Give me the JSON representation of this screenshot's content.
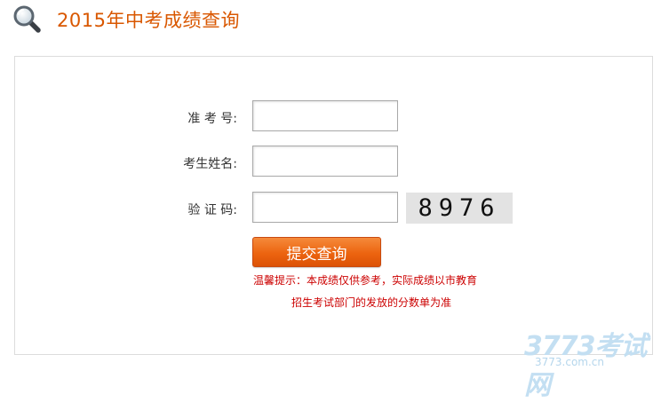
{
  "header": {
    "icon": "search-icon",
    "title": "2015年中考成绩查询"
  },
  "form": {
    "exam_number_label": "准 考 号:",
    "exam_number_value": "",
    "name_label": "考生姓名:",
    "name_value": "",
    "captcha_label": "验 证 码:",
    "captcha_value": "",
    "captcha_image_text": "8976",
    "submit_label": "提交查询"
  },
  "tips": {
    "line1": "温馨提示：本成绩仅供参考，实际成绩以市教育",
    "line2": "招生考试部门的发放的分数单为准"
  },
  "watermark": {
    "logo_text": "3773考试网",
    "url": "3773.com.cn"
  },
  "colors": {
    "title": "#d95700",
    "button": "#ec6410",
    "tip": "#cc0000",
    "watermark": "#c3dff2"
  }
}
